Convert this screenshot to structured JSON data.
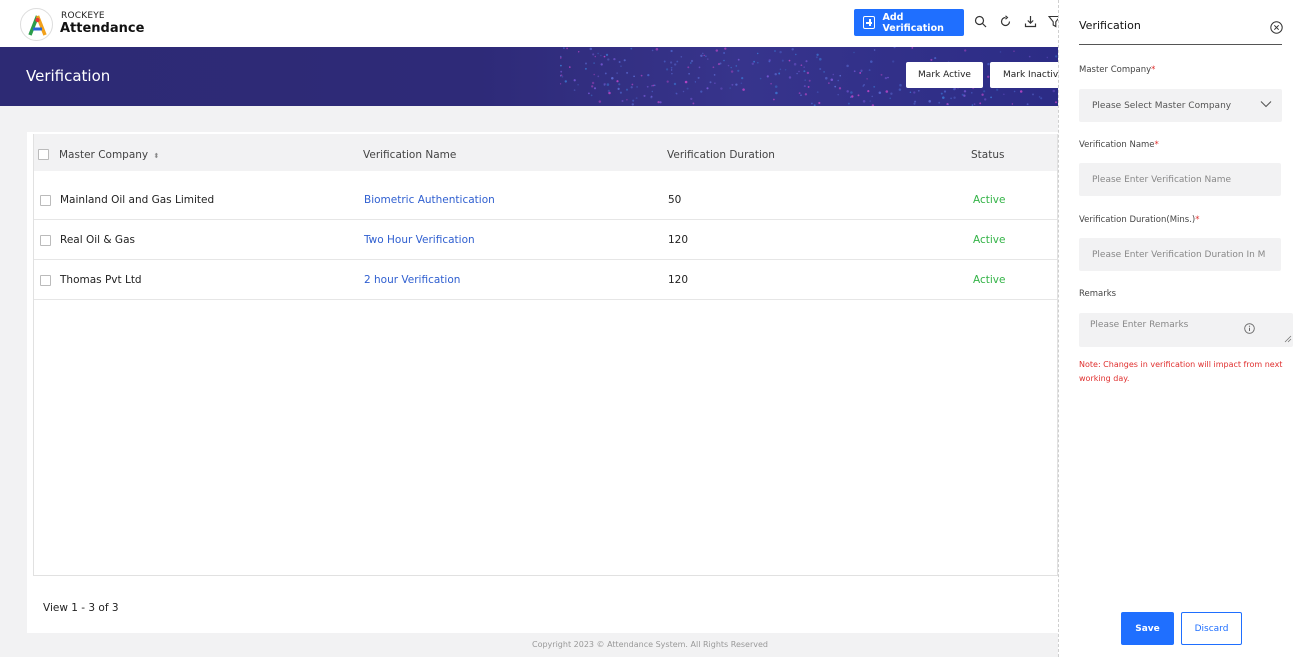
{
  "header": {
    "brand_small": "ROCKEYE",
    "brand_big": "Attendance",
    "add_button_label": "Add Verification",
    "icons": [
      "search-icon",
      "refresh-icon",
      "download-icon",
      "filter-icon"
    ]
  },
  "banner": {
    "title": "Verification",
    "mark_active_label": "Mark Active",
    "mark_inactive_label": "Mark Inactive"
  },
  "table": {
    "columns": [
      "Master Company",
      "Verification Name",
      "Verification Duration",
      "Status"
    ],
    "rows": [
      {
        "company": "Mainland Oil and Gas Limited",
        "name": "Biometric Authentication",
        "duration": "50",
        "status": "Active"
      },
      {
        "company": "Real Oil & Gas",
        "name": "Two Hour Verification",
        "duration": "120",
        "status": "Active"
      },
      {
        "company": "Thomas Pvt Ltd",
        "name": "2 hour Verification",
        "duration": "120",
        "status": "Active"
      }
    ],
    "pager": "View 1 - 3 of 3"
  },
  "footer": {
    "copyright": "Copyright 2023 © Attendance System. All Rights Reserved"
  },
  "panel": {
    "title": "Verification",
    "master_company_label": "Master Company",
    "master_company_placeholder": "Please Select Master Company",
    "verification_name_label": "Verification Name",
    "verification_name_placeholder": "Please Enter Verification Name",
    "duration_label": "Verification Duration(Mins.)",
    "duration_placeholder": "Please Enter Verification Duration In M",
    "remarks_label": "Remarks",
    "remarks_placeholder": "Please Enter Remarks",
    "note": "Note: Changes in verification will impact from next working day.",
    "required_marker": "*",
    "save_label": "Save",
    "discard_label": "Discard"
  },
  "colors": {
    "primary": "#1f6fff",
    "banner": "#2d2a74",
    "active": "#33b347",
    "link": "#2f5fd0",
    "note": "#e0302f"
  }
}
